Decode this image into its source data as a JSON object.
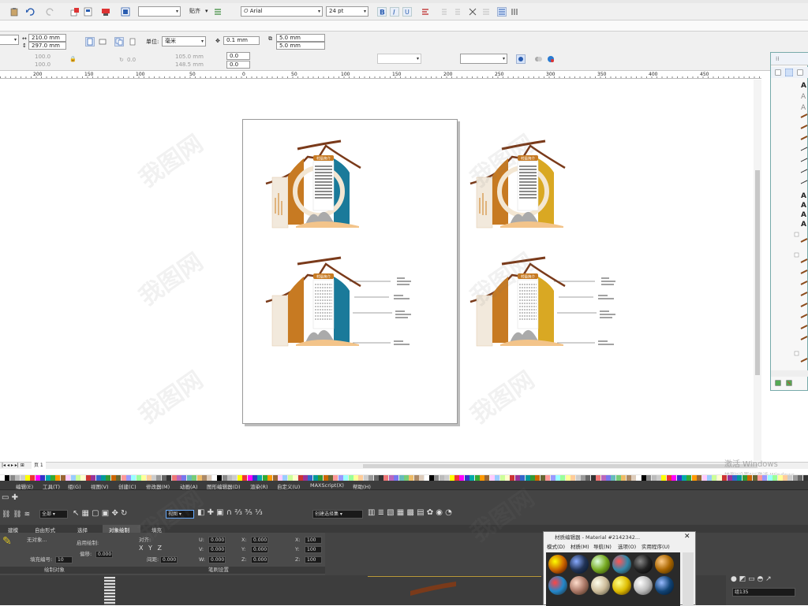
{
  "top": {
    "snap_label": "贴齐",
    "font_name": "Arial",
    "font_size": "24 pt"
  },
  "prop": {
    "width": "210.0 mm",
    "height": "297.0 mm",
    "units_label": "单位:",
    "units_value": "毫米",
    "nudge": "0.1 mm",
    "dup_x": "5.0 mm",
    "dup_y": "5.0 mm",
    "scale_x": "100.0",
    "scale_y": "100.0",
    "rot": "0.0",
    "pos_x": "105.0 mm",
    "pos_y": "148.5 mm",
    "zero1": "0.0",
    "zero2": "0.0"
  },
  "ruler": {
    "ticks": [
      "200",
      "150",
      "100",
      "50",
      "0",
      "50",
      "100",
      "150",
      "200",
      "250",
      "300",
      "350",
      "400",
      "450"
    ]
  },
  "page_tab": "页 1",
  "designs": {
    "title_label": "村级简介"
  },
  "max": {
    "menu": [
      "编辑(E)",
      "工具(T)",
      "组(G)",
      "视图(V)",
      "创建(C)",
      "修改器(M)",
      "动画(A)",
      "图形编辑器(D)",
      "渲染(R)",
      "自定义(U)",
      "MAXScript(X)",
      "帮助(H)"
    ],
    "selection_filter": "全部",
    "view_label": "视图",
    "named_set": "创建选择集",
    "ribbon_tabs": [
      "建模",
      "自由形式",
      "选择",
      "对象绘制",
      "填充"
    ],
    "no_object": "无对象...",
    "use_draw": "启用绘制:",
    "fill_num_label": "填充编号:",
    "fill_num": "10",
    "offset_label": "偏移:",
    "offset_val": "0.000",
    "align_label": "对齐:",
    "spacing_label": "间距:",
    "spacing_val": "0.000",
    "u": "U:",
    "v": "V:",
    "w": "W:",
    "u_val": "0.000",
    "v_val": "0.000",
    "w_val": "0.000",
    "x": "X:",
    "y": "Y:",
    "z": "Z:",
    "x_val": "0.000",
    "y_val": "0.000",
    "z_val": "0.000",
    "xs": "X:",
    "ys": "Y:",
    "zs": "Z:",
    "xs_val": "100",
    "ys_val": "100",
    "zs_val": "100",
    "group_draw": "绘制对象",
    "group_brush": "笔刷设置",
    "mat_title": "材质编辑器 - Material #2142342...",
    "mat_menu": [
      "模式(D)",
      "材质(M)",
      "导航(N)",
      "选项(O)",
      "实用程序(U)"
    ],
    "obj_name": "组135"
  },
  "win": {
    "activate": "激活 Windows",
    "activate_sub": "转到\"设置\"以激活 Windows。"
  }
}
